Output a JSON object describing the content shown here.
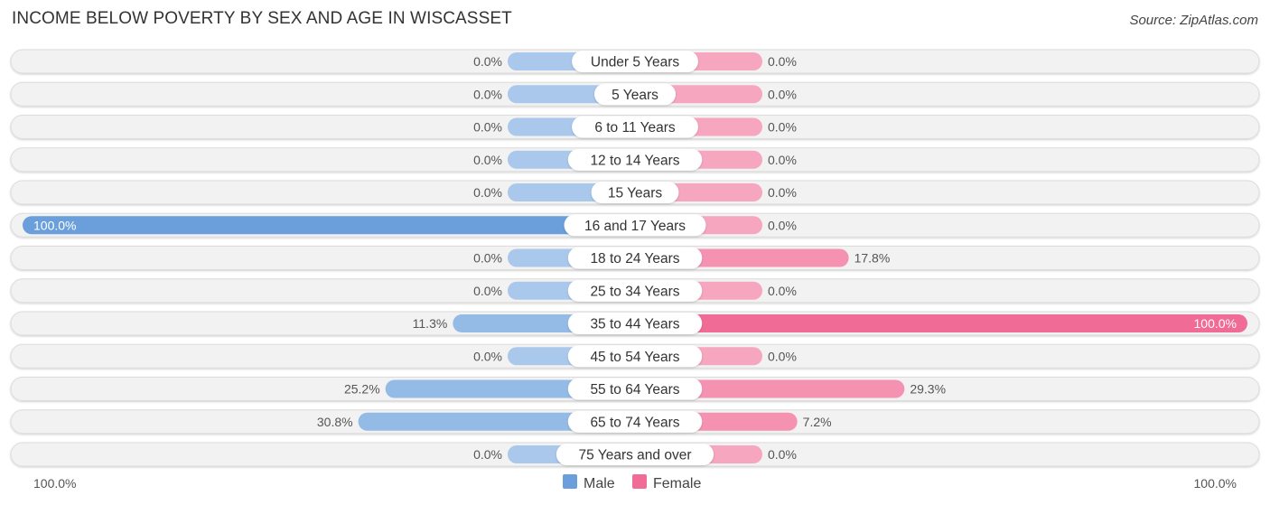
{
  "header": {
    "title": "INCOME BELOW POVERTY BY SEX AND AGE IN WISCASSET",
    "source": "Source: ZipAtlas.com"
  },
  "colors": {
    "male_strong": "#6a9fdb",
    "male_light": "#a9c8ec",
    "female_strong": "#f06b95",
    "female_light": "#f6a6bf",
    "track": "#f2f2f2"
  },
  "chart_data": {
    "type": "bar",
    "orientation": "horizontal-diverging",
    "title": "INCOME BELOW POVERTY BY SEX AND AGE IN WISCASSET",
    "categories": [
      "Under 5 Years",
      "5 Years",
      "6 to 11 Years",
      "12 to 14 Years",
      "15 Years",
      "16 and 17 Years",
      "18 to 24 Years",
      "25 to 34 Years",
      "35 to 44 Years",
      "45 to 54 Years",
      "55 to 64 Years",
      "65 to 74 Years",
      "75 Years and over"
    ],
    "series": [
      {
        "name": "Male",
        "values": [
          0.0,
          0.0,
          0.0,
          0.0,
          0.0,
          100.0,
          0.0,
          0.0,
          11.3,
          0.0,
          25.2,
          30.8,
          0.0
        ],
        "labels": [
          "0.0%",
          "0.0%",
          "0.0%",
          "0.0%",
          "0.0%",
          "100.0%",
          "0.0%",
          "0.0%",
          "11.3%",
          "0.0%",
          "25.2%",
          "30.8%",
          "0.0%"
        ]
      },
      {
        "name": "Female",
        "values": [
          0.0,
          0.0,
          0.0,
          0.0,
          0.0,
          0.0,
          17.8,
          0.0,
          100.0,
          0.0,
          29.3,
          7.2,
          0.0
        ],
        "labels": [
          "0.0%",
          "0.0%",
          "0.0%",
          "0.0%",
          "0.0%",
          "0.0%",
          "17.8%",
          "0.0%",
          "100.0%",
          "0.0%",
          "29.3%",
          "7.2%",
          "0.0%"
        ]
      }
    ],
    "xlim": [
      0,
      100
    ],
    "axis_labels": {
      "left": "100.0%",
      "right": "100.0%"
    },
    "legend": {
      "position": "bottom-center",
      "entries": [
        "Male",
        "Female"
      ]
    }
  }
}
